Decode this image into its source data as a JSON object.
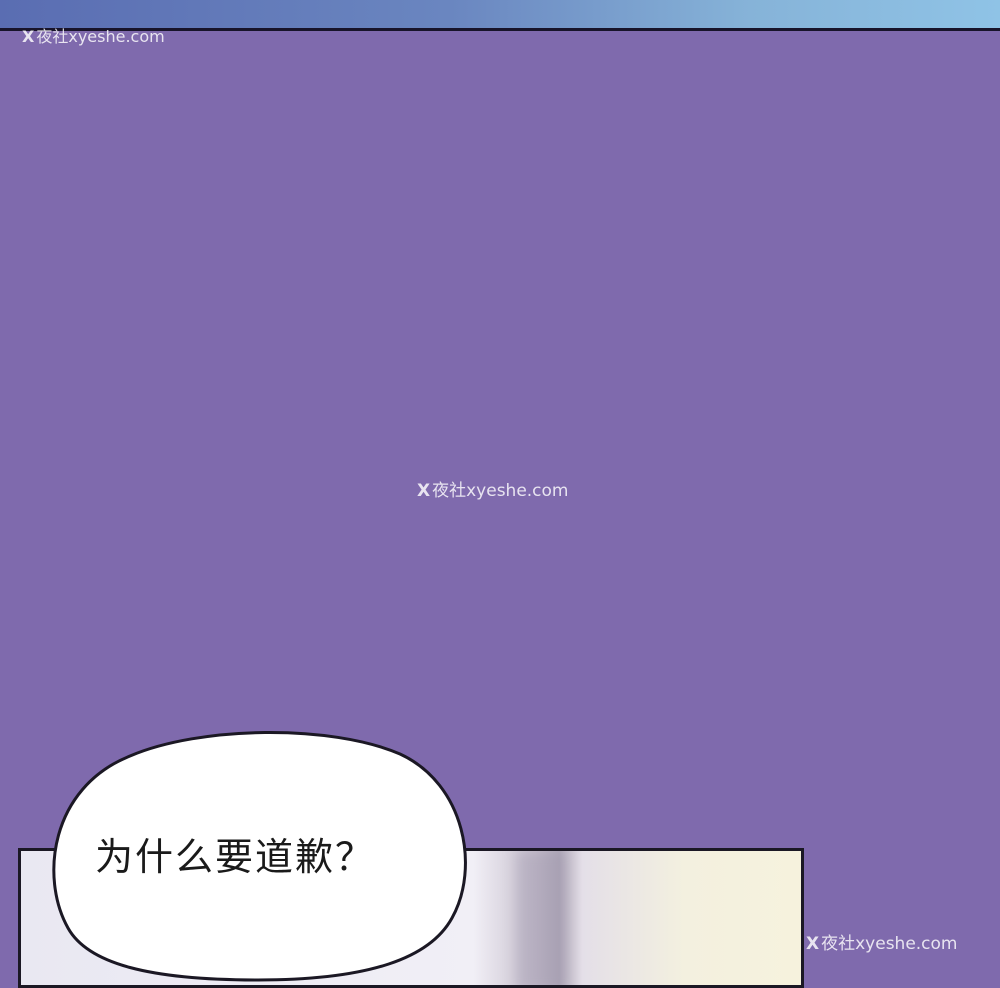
{
  "speech_bubble": {
    "text": "为什么要道歉？"
  },
  "watermarks": [
    {
      "mark": "X",
      "text": "夜社xyeshe.com"
    },
    {
      "mark": "X",
      "text": "夜社xyeshe.com"
    },
    {
      "mark": "X",
      "text": "夜社xyeshe.com"
    }
  ],
  "colors": {
    "background_purple": "#7f6aad",
    "panel_border": "#1b1824",
    "bubble_fill": "#ffffff"
  }
}
